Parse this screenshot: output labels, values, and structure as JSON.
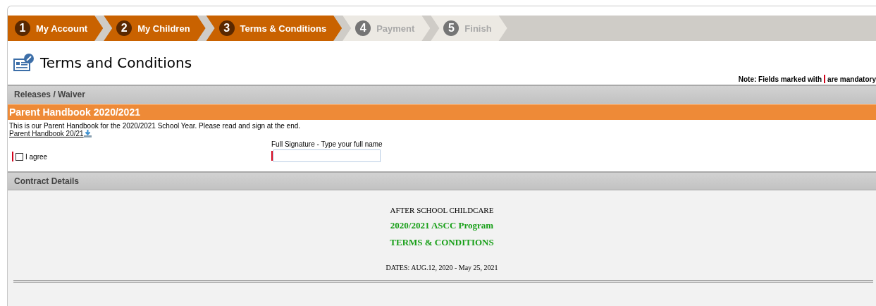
{
  "steps": [
    {
      "number": "1",
      "label": "My Account",
      "done": true
    },
    {
      "number": "2",
      "label": "My Children",
      "done": true
    },
    {
      "number": "3",
      "label": "Terms & Conditions",
      "done": true
    },
    {
      "number": "4",
      "label": "Payment",
      "done": false
    },
    {
      "number": "5",
      "label": "Finish",
      "done": false
    }
  ],
  "page_title": "Terms and Conditions",
  "mandatory_note": {
    "before": "Note: Fields marked with",
    "after": "are mandatory"
  },
  "releases_section": {
    "title": "Releases / Waiver",
    "form_title": "Parent Handbook 2020/2021",
    "description": "This is our Parent Handbook for the 2020/2021 School Year. Please read and sign at the end.",
    "link": "Parent Handbook 20/21",
    "agree": {
      "label": "I agree",
      "checked": false
    },
    "signature": {
      "label": "Full Signature - Type your full name"
    }
  },
  "contract_section": {
    "title": "Contract Details",
    "heading": "AFTER SCHOOL CHILDCARE",
    "program": "2020/2021 ASCC Program",
    "terms": "TERMS & CONDITIONS",
    "dates": "DATES: AUG.12, 2020 - May 25, 2021"
  }
}
